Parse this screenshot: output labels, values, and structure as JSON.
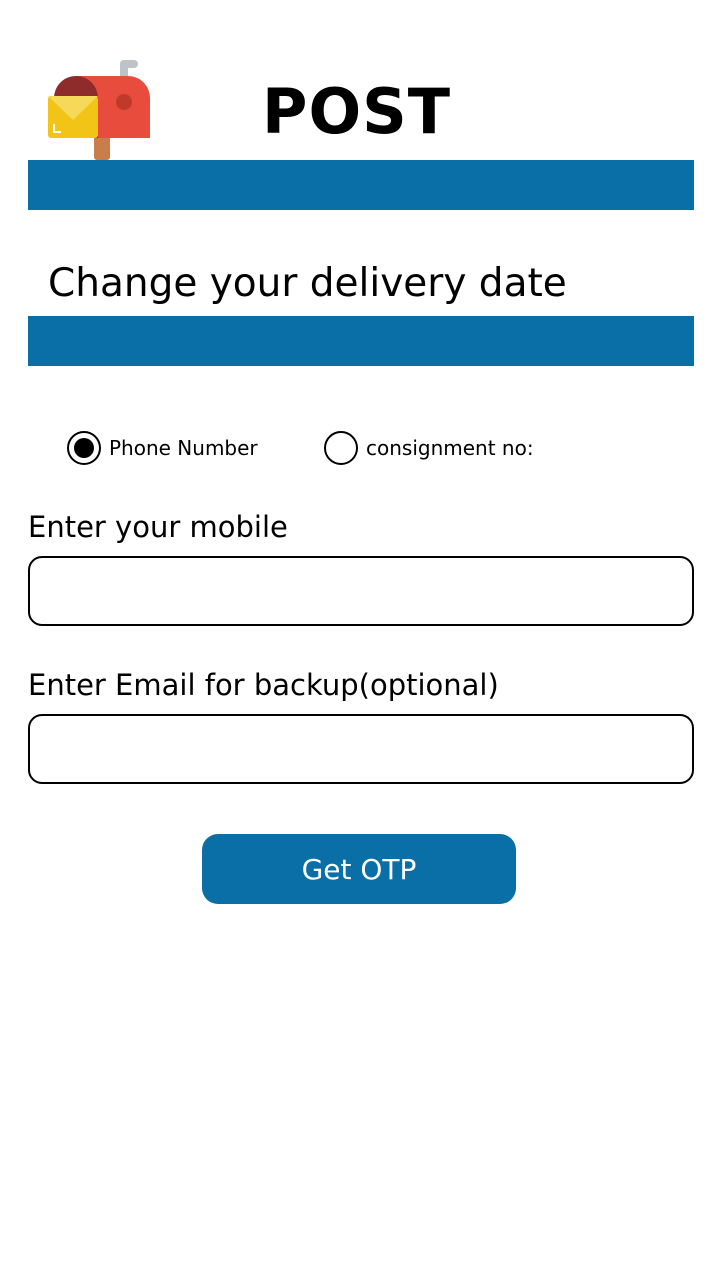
{
  "header": {
    "logo_icon": "mailbox-icon",
    "title": "POST"
  },
  "page": {
    "title": "Change your delivery date"
  },
  "lookup_options": {
    "selected": "phone",
    "items": [
      {
        "id": "phone",
        "label": "Phone Number",
        "selected": true
      },
      {
        "id": "consignment",
        "label": "consignment no:",
        "selected": false
      }
    ]
  },
  "form": {
    "mobile_label": "Enter your mobile",
    "mobile_value": "",
    "email_label": "Enter Email for backup(optional)",
    "email_value": "",
    "submit_label": "Get OTP"
  },
  "colors": {
    "accent": "#0a6fa6",
    "mailbox_red": "#e74c3c",
    "mailbox_dark": "#8e2c2c",
    "envelope_yellow": "#f2c418",
    "post_brown": "#c97d4a",
    "flag_gray": "#bdc3c7"
  }
}
